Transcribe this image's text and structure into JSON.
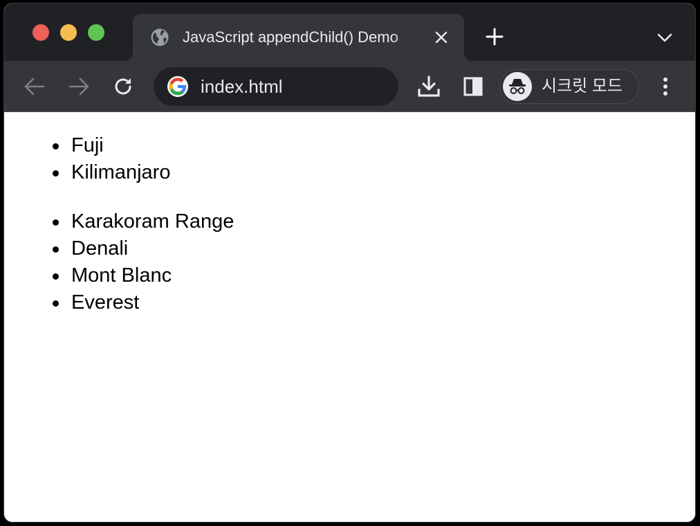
{
  "tab": {
    "title": "JavaScript appendChild() Demo",
    "favicon": "globe-icon"
  },
  "toolbar": {
    "url": "index.html",
    "incognito_label": "시크릿 모드"
  },
  "content": {
    "list1": [
      "Fuji",
      "Kilimanjaro"
    ],
    "list2": [
      "Karakoram Range",
      "Denali",
      "Mont Blanc",
      "Everest"
    ]
  },
  "colors": {
    "tabstrip_bg": "#202124",
    "toolbar_bg": "#35363a",
    "omnibox_bg": "#202124",
    "text_light": "#e8eaed",
    "close_red": "#ee5f57",
    "minimize_yellow": "#f4bd4f",
    "maximize_green": "#60c454"
  }
}
